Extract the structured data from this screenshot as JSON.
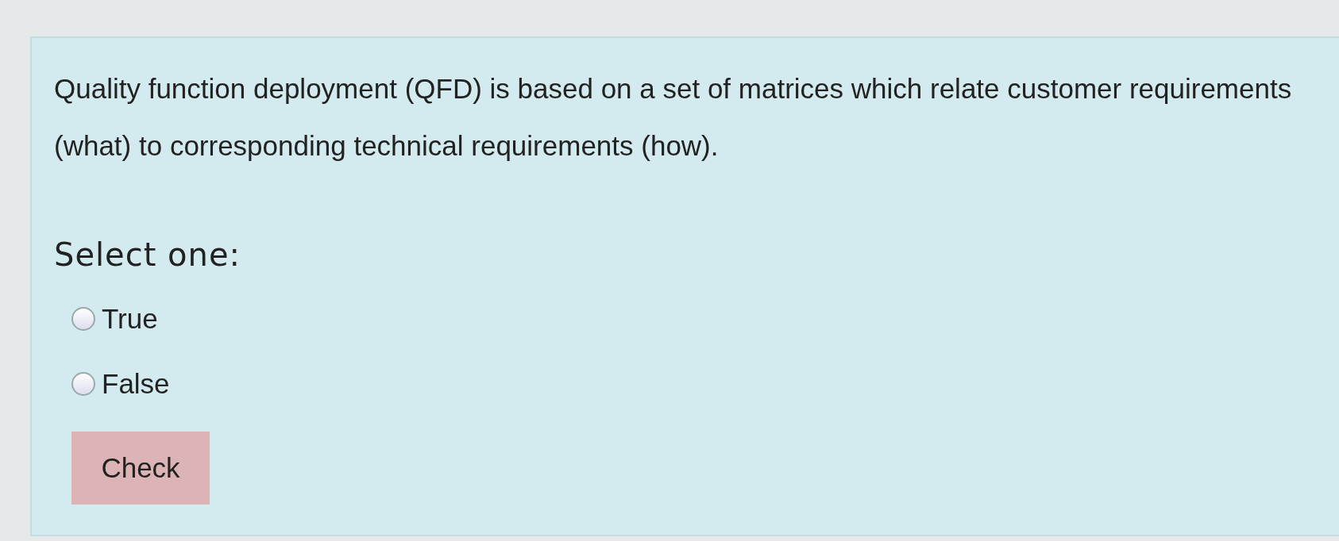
{
  "question": {
    "text": "Quality function deployment (QFD) is based on a set of matrices which relate customer requirements (what) to corresponding technical requirements (how).",
    "prompt": "Select one:",
    "options": [
      {
        "label": "True",
        "selected": false
      },
      {
        "label": "False",
        "selected": false
      }
    ],
    "button": "Check"
  }
}
